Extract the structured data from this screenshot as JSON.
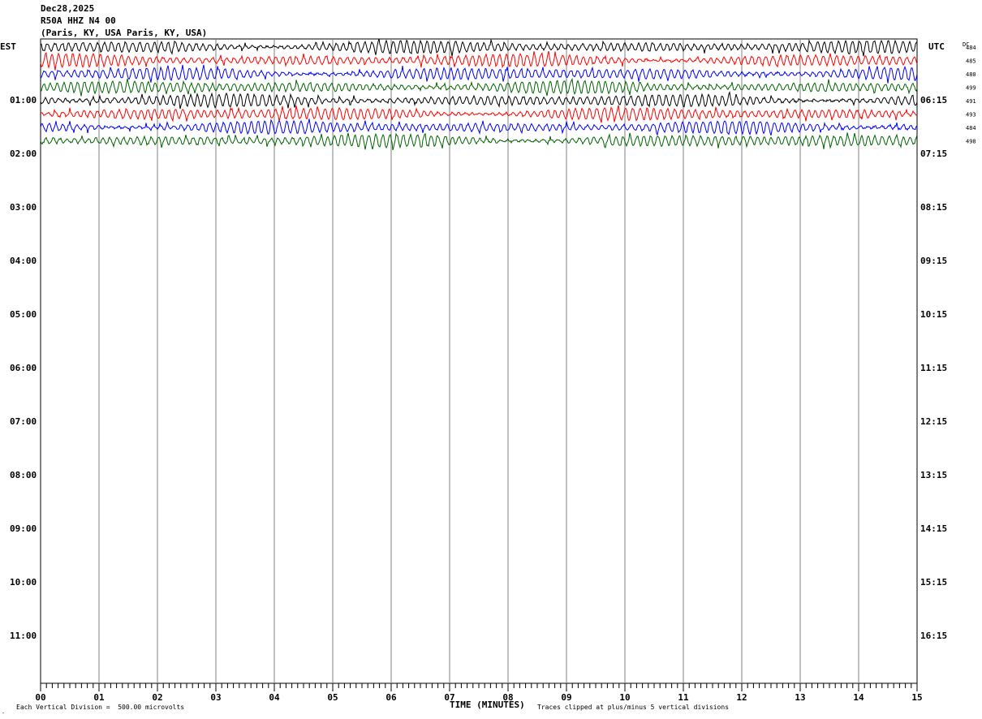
{
  "header": {
    "date": "Dec28,2025",
    "station": "R50A HHZ N4 00",
    "location": "(Paris, KY, USA Paris, KY, USA)"
  },
  "tz": {
    "left": "EST",
    "right": "UTC",
    "dc": "DC"
  },
  "footer": {
    "division": "Each Vertical Division =  500.00 microvolts",
    "xlabel": "TIME (MINUTES)",
    "clip": "Traces clipped at plus/minus 5 vertical divisions",
    "mark": "."
  },
  "chart_data": {
    "type": "line",
    "title": "",
    "xlabel": "TIME (MINUTES)",
    "x_ticks": [
      "00",
      "01",
      "02",
      "03",
      "04",
      "05",
      "06",
      "07",
      "08",
      "09",
      "10",
      "11",
      "12",
      "13",
      "14",
      "15"
    ],
    "xlim": [
      0,
      15
    ],
    "grid": true,
    "left_labels": [
      "",
      "01:00",
      "02:00",
      "03:00",
      "04:00",
      "05:00",
      "06:00",
      "07:00",
      "08:00",
      "09:00",
      "10:00",
      "11:00"
    ],
    "right_labels": [
      "",
      "06:15",
      "07:15",
      "08:15",
      "09:15",
      "10:15",
      "11:15",
      "12:15",
      "13:15",
      "14:15",
      "15:15",
      "16:15"
    ],
    "trace_colors": [
      "#000000",
      "#ff0000",
      "#0000ff",
      "#006400"
    ],
    "traces": [
      {
        "dc": "484",
        "color": "#000000"
      },
      {
        "dc": "485",
        "color": "#ff0000"
      },
      {
        "dc": "480",
        "color": "#0000ff"
      },
      {
        "dc": "499",
        "color": "#006400"
      },
      {
        "dc": "491",
        "color": "#000000"
      },
      {
        "dc": "493",
        "color": "#ff0000"
      },
      {
        "dc": "484",
        "color": "#0000ff"
      },
      {
        "dc": "498",
        "color": "#006400"
      }
    ]
  }
}
